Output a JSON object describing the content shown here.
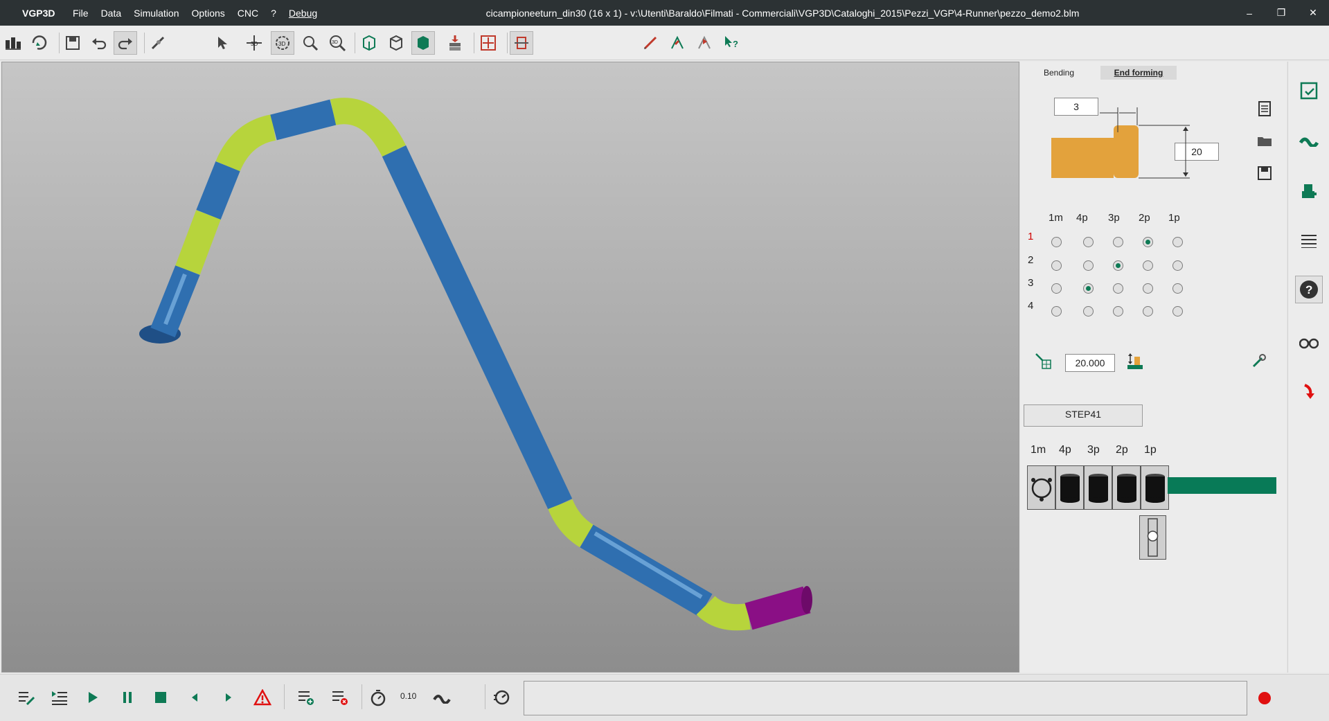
{
  "app_name": "VGP3D",
  "menu": [
    "File",
    "Data",
    "Simulation",
    "Options",
    "CNC",
    "?",
    "Debug"
  ],
  "window_title": "cicampioneeturn_din30 (16 x 1) - v:\\Utenti\\Baraldo\\Filmati - Commerciali\\VGP3D\\Cataloghi_2015\\Pezzi_VGP\\4-Runner\\pezzo_demo2.blm",
  "window_controls": {
    "minimize": "–",
    "restore": "❐",
    "close": "✕"
  },
  "tabs": {
    "bending": "Bending",
    "end_forming": "End forming"
  },
  "end_forming": {
    "length_value": "3",
    "diameter_value": "20",
    "columns": [
      "1m",
      "4p",
      "3p",
      "2p",
      "1p"
    ],
    "rows": [
      "1",
      "2",
      "3",
      "4"
    ],
    "selection": [
      3,
      2,
      1,
      null
    ],
    "position_value": "20.000",
    "step_label": "STEP41",
    "tool_columns": [
      "1m",
      "4p",
      "3p",
      "2p",
      "1p"
    ]
  },
  "simulation": {
    "speed": "0.10"
  },
  "colors": {
    "title_bg": "#2c3234",
    "accent_green": "#087a57",
    "tube_blue": "#2f6fb0",
    "tube_bend": "#b7d43c",
    "tube_end": "#8a0f85",
    "record_red": "#e01010"
  },
  "icons": {
    "toolbar": [
      "machine-icon",
      "rotate-part-icon",
      "save-icon",
      "undo-icon",
      "redo-icon",
      "transform-icon",
      "select-arrow-icon",
      "move-3d-icon",
      "rotate-3d-icon",
      "zoom-icon",
      "zoom-3d-icon",
      "view-front-icon",
      "view-side-icon",
      "view-solid-icon",
      "stack-icon",
      "center-icon",
      "fit-icon",
      "measure-icon",
      "bend-angle-icon",
      "bend-plane-icon",
      "help-pointer-icon"
    ]
  }
}
